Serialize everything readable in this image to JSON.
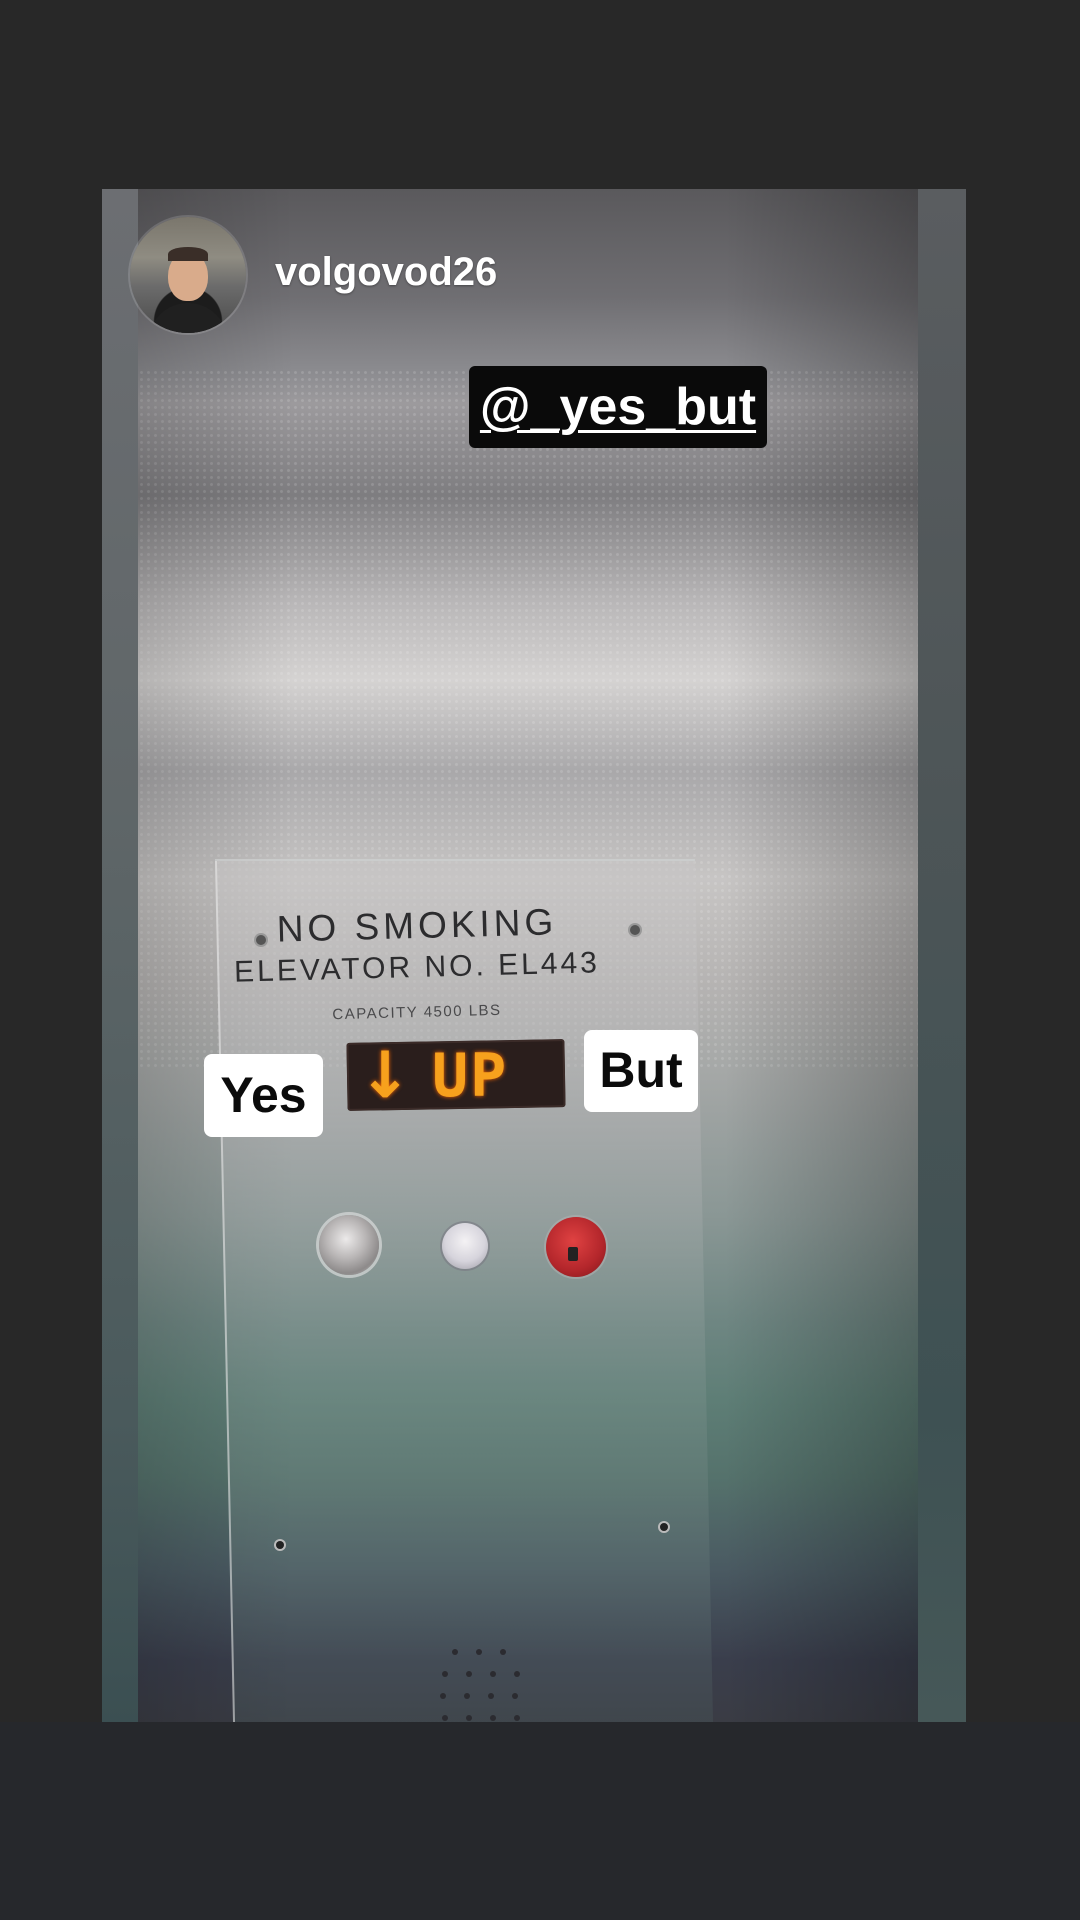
{
  "story": {
    "username": "volgovod26",
    "mention": "@_yes_but"
  },
  "stickers": {
    "yes": "Yes",
    "but": "But"
  },
  "sign": {
    "line1": "NO SMOKING",
    "line2": "ELEVATOR NO. EL443",
    "line3": "CAPACITY 4500 LBS"
  },
  "display": {
    "arrow": "↓",
    "text": "UP"
  }
}
